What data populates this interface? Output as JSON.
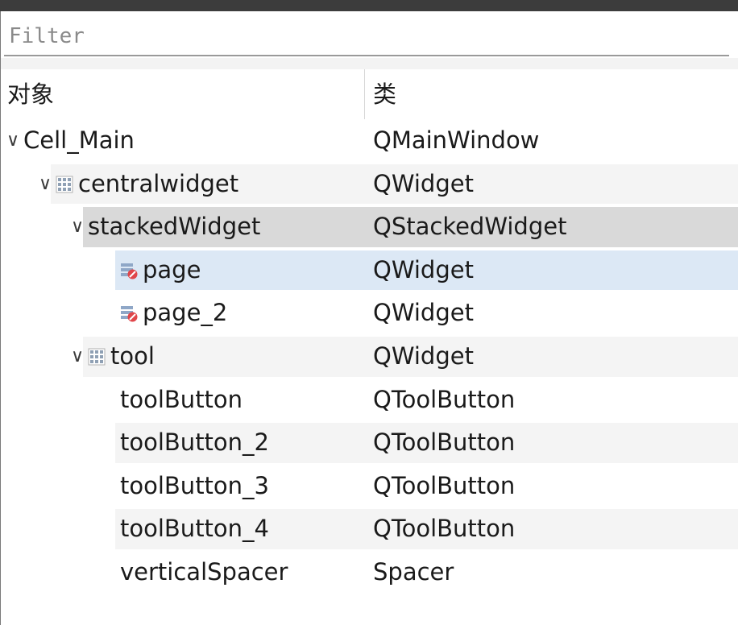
{
  "filter": {
    "placeholder": "Filter",
    "value": ""
  },
  "header": {
    "object_label": "对象",
    "class_label": "类"
  },
  "colors": {
    "alt_row": "#f4f4f4",
    "current_row": "#d9d9d9",
    "selected_row": "#dce8f5"
  },
  "tree": [
    {
      "name": "Cell_Main",
      "class": "QMainWindow",
      "depth": 0,
      "expanded": true,
      "icon": "",
      "state": ""
    },
    {
      "name": "centralwidget",
      "class": "QWidget",
      "depth": 1,
      "expanded": true,
      "icon": "grid-layout-icon",
      "state": "alt"
    },
    {
      "name": "stackedWidget",
      "class": "QStackedWidget",
      "depth": 2,
      "expanded": true,
      "icon": "",
      "state": "current"
    },
    {
      "name": "page",
      "class": "QWidget",
      "depth": 3,
      "expanded": null,
      "icon": "broken-layout-icon",
      "state": "selected"
    },
    {
      "name": "page_2",
      "class": "QWidget",
      "depth": 3,
      "expanded": null,
      "icon": "broken-layout-icon",
      "state": ""
    },
    {
      "name": "tool",
      "class": "QWidget",
      "depth": 2,
      "expanded": true,
      "icon": "grid-layout-icon",
      "state": "alt"
    },
    {
      "name": "toolButton",
      "class": "QToolButton",
      "depth": 3,
      "expanded": null,
      "icon": "",
      "state": ""
    },
    {
      "name": "toolButton_2",
      "class": "QToolButton",
      "depth": 3,
      "expanded": null,
      "icon": "",
      "state": "alt"
    },
    {
      "name": "toolButton_3",
      "class": "QToolButton",
      "depth": 3,
      "expanded": null,
      "icon": "",
      "state": ""
    },
    {
      "name": "toolButton_4",
      "class": "QToolButton",
      "depth": 3,
      "expanded": null,
      "icon": "",
      "state": "alt"
    },
    {
      "name": "verticalSpacer",
      "class": "Spacer",
      "depth": 3,
      "expanded": null,
      "icon": "",
      "state": ""
    }
  ]
}
